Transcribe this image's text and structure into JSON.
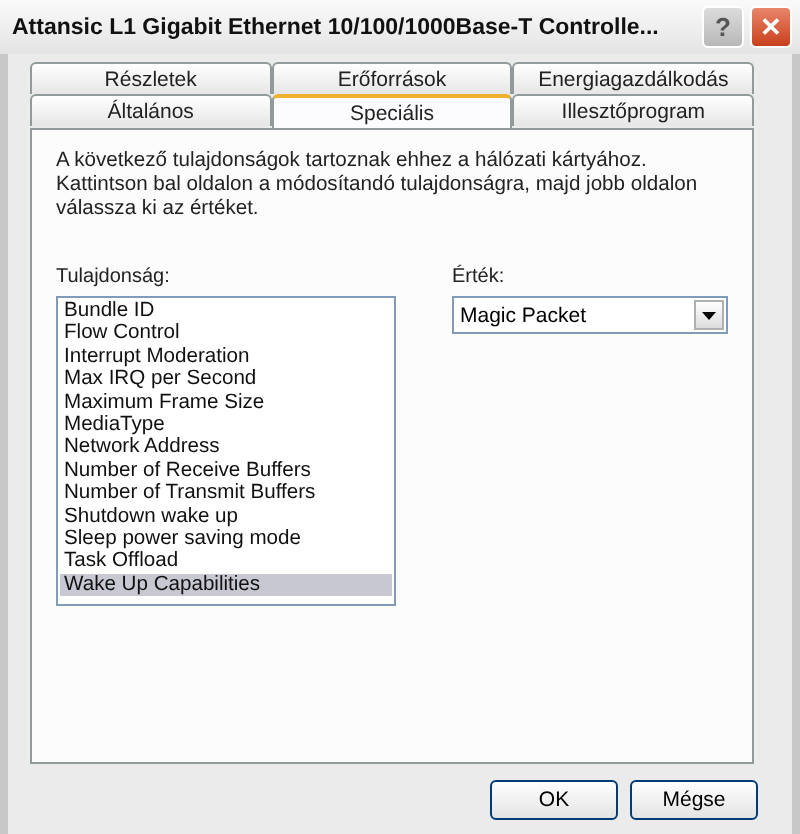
{
  "window": {
    "title": "Attansic L1 Gigabit Ethernet 10/100/1000Base-T Controlle..."
  },
  "title_buttons": [
    {
      "kind": "help",
      "label": "?"
    },
    {
      "kind": "close",
      "label": "✕"
    }
  ],
  "tab_rows": [
    {
      "tabs": [
        {
          "label": "Részletek",
          "selected": false
        },
        {
          "label": "Erőforrások",
          "selected": false
        },
        {
          "label": "Energiagazdálkodás",
          "selected": false
        }
      ]
    },
    {
      "tabs": [
        {
          "label": "Általános",
          "selected": false
        },
        {
          "label": "Speciális",
          "selected": true
        },
        {
          "label": "Illesztőprogram",
          "selected": false
        }
      ]
    }
  ],
  "description": "A következő tulajdonságok tartoznak ehhez a hálózati kártyához. Kattintson bal oldalon a módosítandó tulajdonságra, majd jobb oldalon válassza ki az értéket.",
  "property_label": "Tulajdonság:",
  "properties": [
    {
      "label": "Bundle ID",
      "selected": false
    },
    {
      "label": "Flow Control",
      "selected": false
    },
    {
      "label": "Interrupt Moderation",
      "selected": false
    },
    {
      "label": "Max IRQ per Second",
      "selected": false
    },
    {
      "label": "Maximum Frame Size",
      "selected": false
    },
    {
      "label": "MediaType",
      "selected": false
    },
    {
      "label": "Network Address",
      "selected": false
    },
    {
      "label": "Number of Receive Buffers",
      "selected": false
    },
    {
      "label": "Number of Transmit Buffers",
      "selected": false
    },
    {
      "label": "Shutdown wake up",
      "selected": false
    },
    {
      "label": "Sleep power saving mode",
      "selected": false
    },
    {
      "label": "Task Offload",
      "selected": false
    },
    {
      "label": "Wake Up Capabilities",
      "selected": true
    }
  ],
  "value_label": "Érték:",
  "value_dropdown": {
    "value": "Magic Packet"
  },
  "buttons": [
    "OK",
    "Mégse"
  ]
}
